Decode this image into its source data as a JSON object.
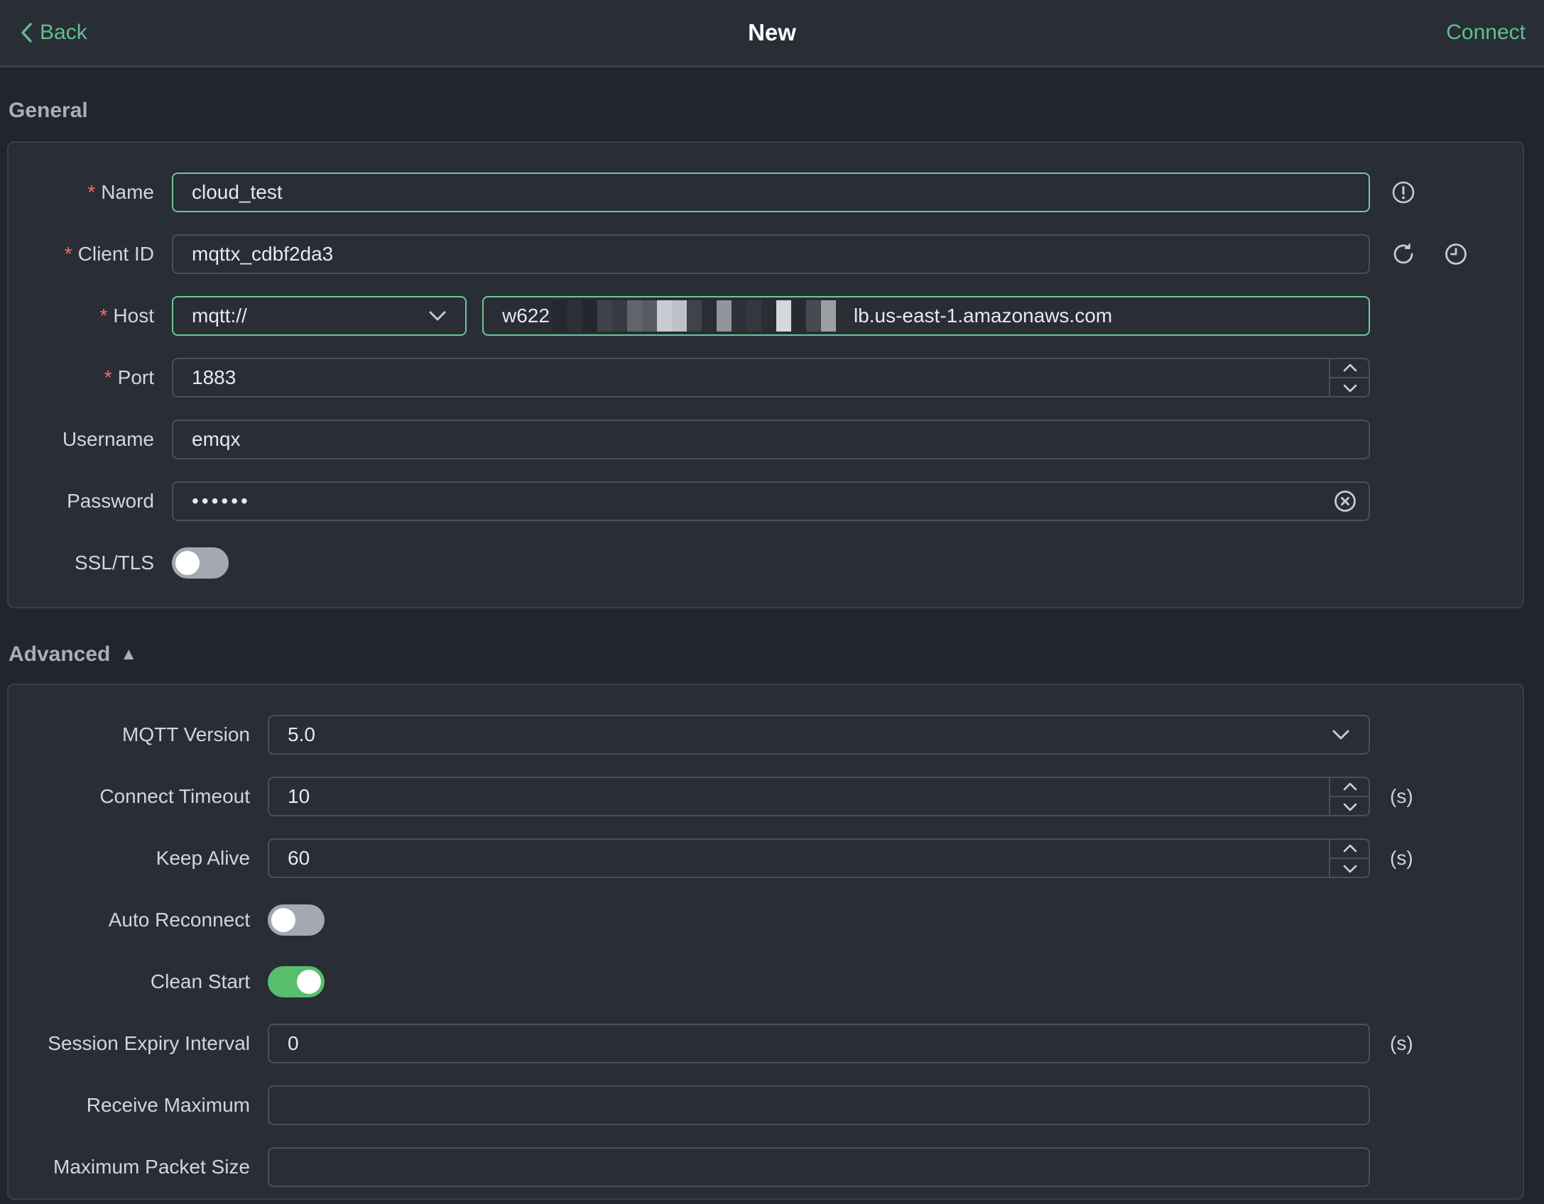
{
  "topbar": {
    "back_label": "Back",
    "title": "New",
    "connect_label": "Connect"
  },
  "required_marker": "*",
  "general": {
    "section_title": "General",
    "fields": {
      "name": {
        "label": "Name",
        "value": "cloud_test"
      },
      "client_id": {
        "label": "Client ID",
        "value": "mqttx_cdbf2da3"
      },
      "host": {
        "label": "Host",
        "protocol": "mqtt://",
        "value_prefix": "w622",
        "value_suffix": "lb.us-east-1.amazonaws.com"
      },
      "port": {
        "label": "Port",
        "value": "1883"
      },
      "username": {
        "label": "Username",
        "value": "emqx"
      },
      "password": {
        "label": "Password",
        "value": "••••••"
      },
      "ssl": {
        "label": "SSL/TLS",
        "state": "off"
      }
    }
  },
  "advanced": {
    "section_title": "Advanced",
    "collapse_indicator": "▲",
    "fields": {
      "mqtt_version": {
        "label": "MQTT Version",
        "value": "5.0"
      },
      "connect_timeout": {
        "label": "Connect Timeout",
        "value": "10",
        "unit": "(s)"
      },
      "keep_alive": {
        "label": "Keep Alive",
        "value": "60",
        "unit": "(s)"
      },
      "auto_reconnect": {
        "label": "Auto Reconnect",
        "state": "off"
      },
      "clean_start": {
        "label": "Clean Start",
        "state": "on"
      },
      "session_expiry": {
        "label": "Session Expiry Interval",
        "value": "0",
        "unit": "(s)"
      },
      "receive_maximum": {
        "label": "Receive Maximum",
        "value": ""
      },
      "max_packet_size": {
        "label": "Maximum Packet Size",
        "value": ""
      }
    }
  },
  "colors": {
    "accent_green_text": "#61bf8c",
    "accent_green_border": "#6fc796",
    "toggle_on_green": "#57be6b",
    "required_red": "#f56c6c"
  }
}
